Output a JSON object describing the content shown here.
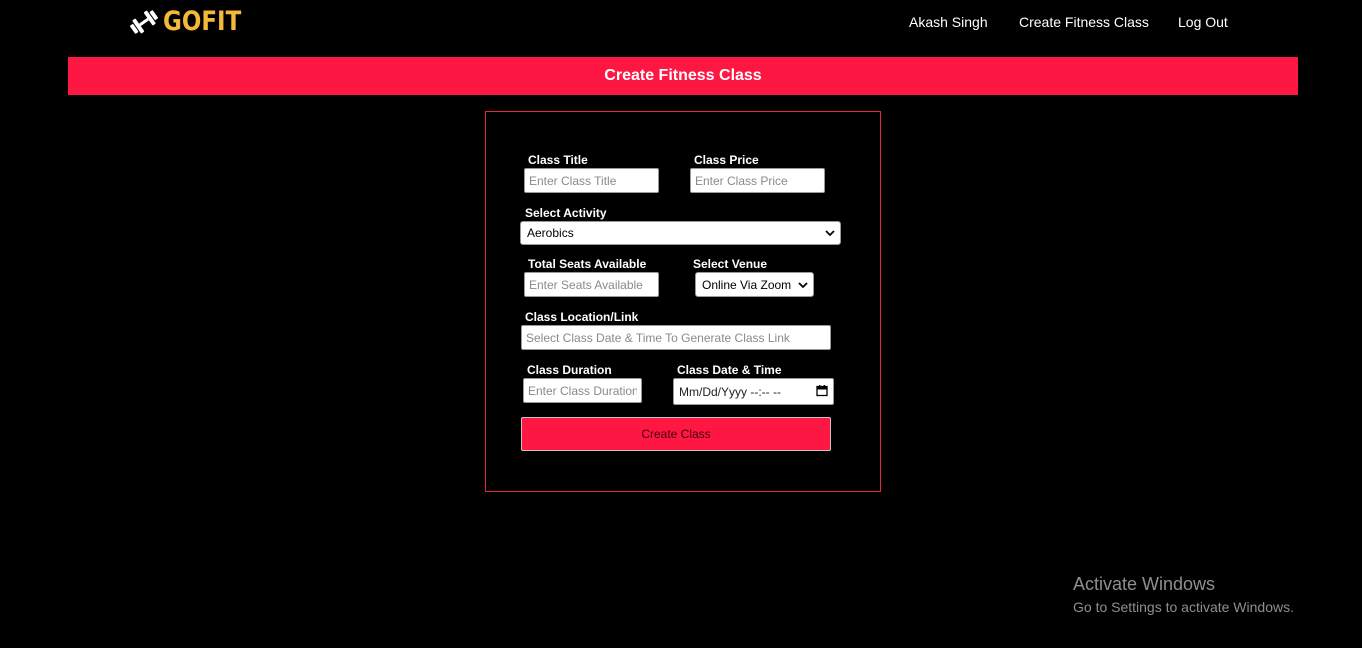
{
  "brand": {
    "logo_text": "GOFIT",
    "logo_icon": "dumbbell-icon",
    "accent_color": "#f4b83a"
  },
  "nav": {
    "user_name": "Akash Singh",
    "create_class": "Create Fitness Class",
    "logout": "Log Out"
  },
  "banner": {
    "title": "Create Fitness Class",
    "color": "#ff1744"
  },
  "form": {
    "class_title": {
      "label": "Class Title",
      "placeholder": "Enter Class Title"
    },
    "class_price": {
      "label": "Class Price",
      "placeholder": "Enter Class Price"
    },
    "activity": {
      "label": "Select Activity",
      "selected": "Aerobics"
    },
    "seats": {
      "label": "Total Seats Available",
      "placeholder": "Enter Seats Available"
    },
    "venue": {
      "label": "Select Venue",
      "selected": "Online Via Zoom"
    },
    "location": {
      "label": "Class Location/Link",
      "placeholder": "Select Class Date & Time To Generate Class Link"
    },
    "duration": {
      "label": "Class Duration",
      "placeholder": "Enter Class Duration"
    },
    "datetime": {
      "label": "Class Date & Time",
      "value": "Mm/Dd/Yyyy --:-- --"
    },
    "submit_label": "Create Class"
  },
  "watermark": {
    "title": "Activate Windows",
    "subtitle": "Go to Settings to activate Windows."
  }
}
